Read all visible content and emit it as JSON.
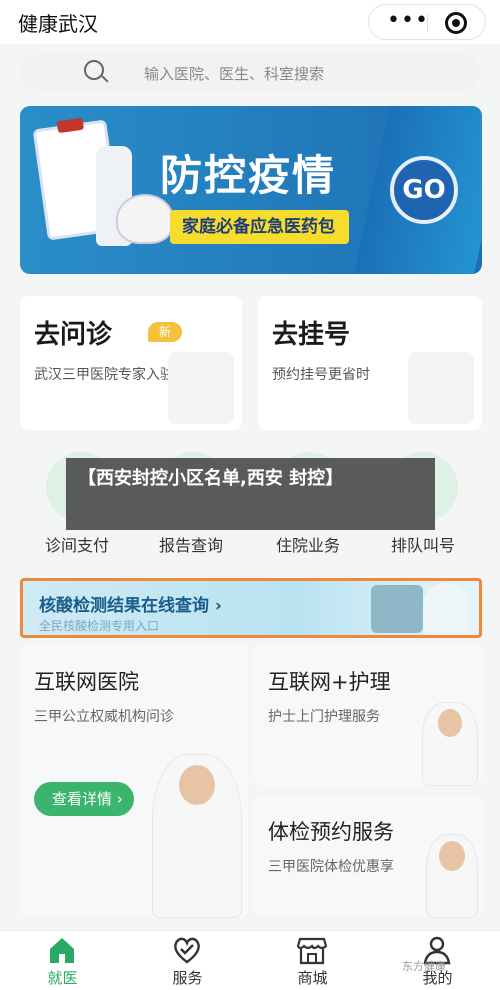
{
  "header": {
    "title": "健康武汉"
  },
  "search": {
    "placeholder": "输入医院、医生、科室搜索"
  },
  "banner": {
    "title": "防控疫情",
    "subtitle": "家庭必备应急医药包",
    "go": "GO"
  },
  "cards": [
    {
      "title": "去问诊",
      "badge": "新",
      "subtitle": "武汉三甲医院专家入驻"
    },
    {
      "title": "去挂号",
      "subtitle": "预约挂号更省时"
    }
  ],
  "quick_links": [
    "诊间支付",
    "报告查询",
    "住院业务",
    "排队叫号"
  ],
  "overlay_caption": "【西安封控小区名单,西安 封控】",
  "test_banner": {
    "title": "核酸检测结果在线查询 ›",
    "subtitle": "全民核酸检测专用入口"
  },
  "services": [
    {
      "title": "互联网医院",
      "subtitle": "三甲公立权威机构问诊",
      "button": "查看详情 ›"
    },
    {
      "title": "互联网+护理",
      "subtitle": "护士上门护理服务"
    },
    {
      "title": "体检预约服务",
      "subtitle": "三甲医院体检优惠享"
    }
  ],
  "tabbar": [
    {
      "label": "就医",
      "icon": "home-icon",
      "active": true
    },
    {
      "label": "服务",
      "icon": "heart-icon"
    },
    {
      "label": "商城",
      "icon": "shop-icon"
    },
    {
      "label": "我的",
      "icon": "user-icon"
    }
  ],
  "watermark": "东方健康",
  "colors": {
    "accent_green": "#3bb56e",
    "banner_blue": "#2a8ec8",
    "badge_yellow": "#f3c23a",
    "highlight_orange": "#f0883c"
  }
}
